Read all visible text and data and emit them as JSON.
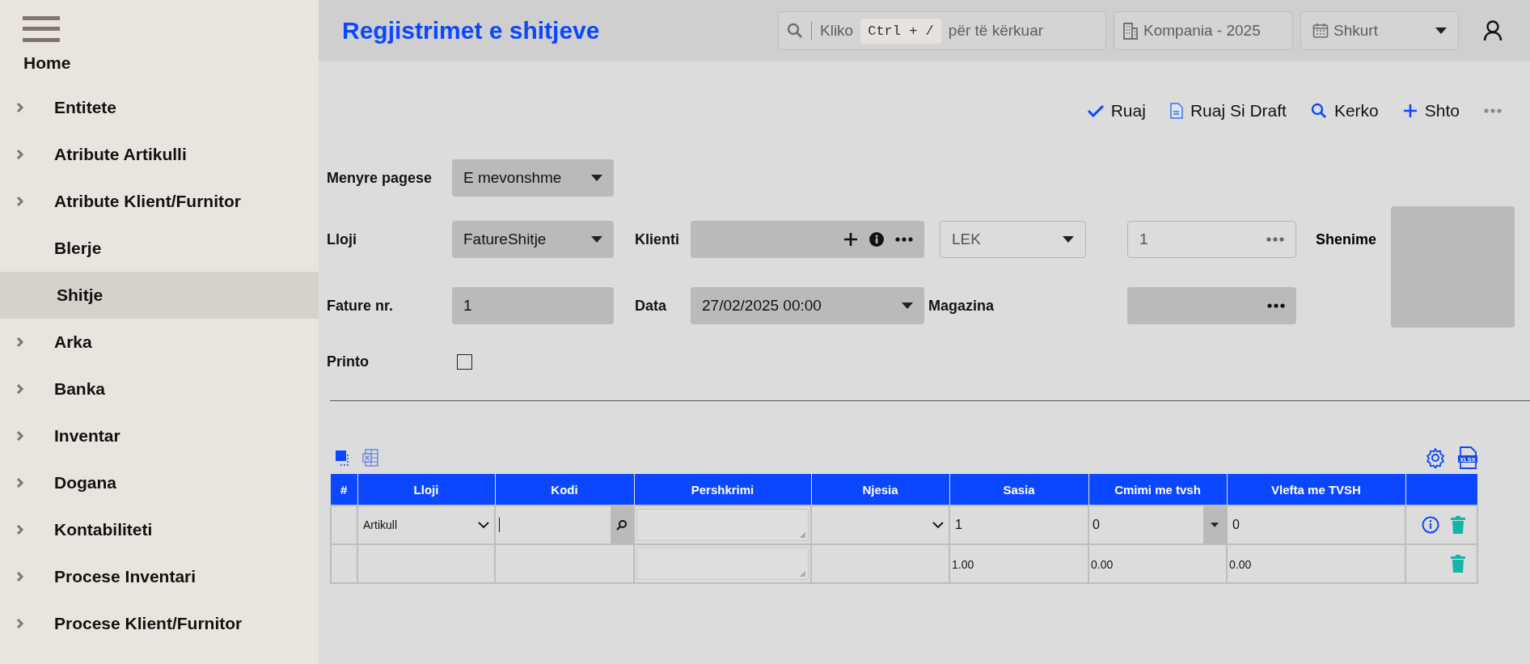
{
  "sidebar": {
    "items": [
      {
        "label": "Home",
        "kind": "home",
        "has_children": false,
        "selected": false
      },
      {
        "label": "Entitete",
        "kind": "item",
        "has_children": true,
        "selected": false
      },
      {
        "label": "Atribute Artikulli",
        "kind": "item",
        "has_children": true,
        "selected": false
      },
      {
        "label": "Atribute Klient/Furnitor",
        "kind": "item",
        "has_children": true,
        "selected": false
      },
      {
        "label": "Blerje",
        "kind": "item",
        "has_children": false,
        "selected": false
      },
      {
        "label": "Shitje",
        "kind": "item",
        "has_children": false,
        "selected": true
      },
      {
        "label": "Arka",
        "kind": "item",
        "has_children": true,
        "selected": false
      },
      {
        "label": "Banka",
        "kind": "item",
        "has_children": true,
        "selected": false
      },
      {
        "label": "Inventar",
        "kind": "item",
        "has_children": true,
        "selected": false
      },
      {
        "label": "Dogana",
        "kind": "item",
        "has_children": true,
        "selected": false
      },
      {
        "label": "Kontabiliteti",
        "kind": "item",
        "has_children": true,
        "selected": false
      },
      {
        "label": "Procese Inventari",
        "kind": "item",
        "has_children": true,
        "selected": false
      },
      {
        "label": "Procese Klient/Furnitor",
        "kind": "item",
        "has_children": true,
        "selected": false
      }
    ]
  },
  "header": {
    "title": "Regjistrimet e shitjeve",
    "search": {
      "prefix": "Kliko",
      "shortcut": "Ctrl + /",
      "suffix": "për të kërkuar"
    },
    "company": "Kompania - 2025",
    "period": "Shkurt"
  },
  "actions": [
    {
      "kind": "save",
      "label": "Ruaj"
    },
    {
      "kind": "draft",
      "label": "Ruaj Si Draft"
    },
    {
      "kind": "search",
      "label": "Kerko"
    },
    {
      "kind": "add",
      "label": "Shto"
    },
    {
      "kind": "more"
    }
  ],
  "form": {
    "rows": [
      [
        {
          "kind": "label",
          "text": "Menyre pagese"
        },
        {
          "kind": "select",
          "value": "E mevonshme",
          "disabled": false
        }
      ],
      [
        {
          "kind": "label",
          "text": "Lloji"
        },
        {
          "kind": "select",
          "value": "FatureShitje",
          "disabled": false
        },
        {
          "kind": "label",
          "text": "Klienti"
        },
        {
          "kind": "client",
          "disabled": false
        },
        {
          "kind": "select",
          "value": "LEK",
          "disabled": true
        },
        {
          "kind": "lookup",
          "value": "1",
          "disabled": true
        }
      ],
      [
        {
          "kind": "label",
          "text": "Fature nr."
        },
        {
          "kind": "text",
          "value": "1",
          "disabled": false
        },
        {
          "kind": "label",
          "text": "Data"
        },
        {
          "kind": "select",
          "value": "27/02/2025 00:00",
          "disabled": false
        },
        {
          "kind": "label",
          "text": "Magazina"
        },
        {
          "kind": "lookup",
          "disabled": false
        }
      ],
      [
        {
          "kind": "label",
          "text": "Printo"
        },
        {
          "kind": "checkbox",
          "checked": false
        }
      ]
    ],
    "notes": {
      "label": "Shenime"
    }
  },
  "table": {
    "export_label": "XLSX",
    "columns": [
      "#",
      "Lloji",
      "Kodi",
      "Pershkrimi",
      "Njesia",
      "Sasia",
      "Cmimi me tvsh",
      "Vlefta me TVSH"
    ],
    "rows": [
      {
        "cells": [
          {
            "kind": "plain"
          },
          {
            "kind": "select",
            "value": "Artikull"
          },
          {
            "kind": "search"
          },
          {
            "kind": "textarea"
          },
          {
            "kind": "select"
          },
          {
            "kind": "input",
            "value": "1"
          },
          {
            "kind": "dropdown",
            "value": "0"
          },
          {
            "kind": "input",
            "value": "0"
          }
        ],
        "actions": [
          {
            "kind": "info"
          },
          {
            "kind": "delete"
          }
        ]
      },
      {
        "cells": [
          {
            "kind": "plain"
          },
          {
            "kind": "plain"
          },
          {
            "kind": "plain"
          },
          {
            "kind": "textarea"
          },
          {
            "kind": "plain"
          },
          {
            "kind": "plain",
            "value": "1.00"
          },
          {
            "kind": "plain",
            "value": "0.00"
          },
          {
            "kind": "plain",
            "value": "0.00"
          }
        ],
        "actions": [
          {
            "kind": "delete"
          }
        ]
      }
    ]
  }
}
